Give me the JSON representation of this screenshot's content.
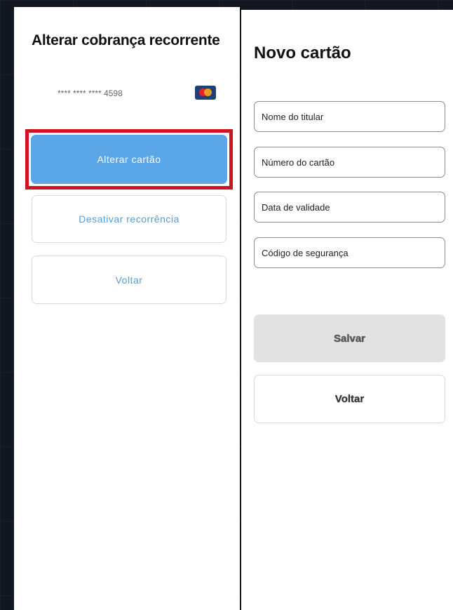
{
  "recurring_billing": {
    "title": "Alterar cobrança recorrente",
    "card_number_masked": "**** **** **** 4598",
    "card_brand_icon": "mastercard-icon",
    "change_card_label": "Alterar cartão",
    "disable_recurrence_label": "Desativar recorrência",
    "back_label": "Voltar"
  },
  "new_card": {
    "title": "Novo cartão",
    "fields": {
      "holder_name_placeholder": "Nome do titular",
      "card_number_placeholder": "Número do cartão",
      "expiry_date_placeholder": "Data de validade",
      "security_code_placeholder": "Código de segurança"
    },
    "save_label": "Salvar",
    "back_label": "Voltar"
  },
  "colors": {
    "primary_button": "#5aa6e6",
    "highlight_border": "#d2121f",
    "secondary_text": "#5a9ccf",
    "disabled_button": "#e2e2e2",
    "background": "#111620"
  }
}
